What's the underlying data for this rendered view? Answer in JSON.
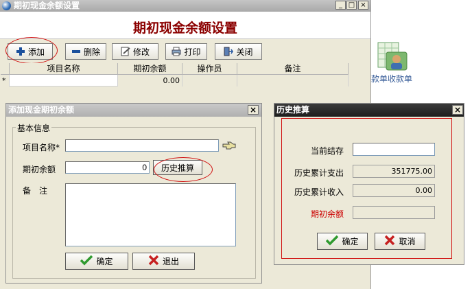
{
  "desktop": {
    "shortcut_label": "款单收款单"
  },
  "main_window": {
    "title": "期初现金余额设置",
    "heading": "期初现金余额设置",
    "toolbar": {
      "add": "添加",
      "delete": "删除",
      "edit": "修改",
      "print": "打印",
      "close": "关闭"
    },
    "grid": {
      "columns": [
        "项目名称",
        "期初余额",
        "操作员",
        "备注"
      ],
      "new_row_marker": "*",
      "new_row_balance": "0.00"
    }
  },
  "add_dialog": {
    "title": "添加现金期初余额",
    "group_title": "基本信息",
    "item_name_label": "项目名称*",
    "item_name_value": "",
    "opening_balance_label": "期初余额",
    "opening_balance_value": "0",
    "history_button": "历史推算",
    "note_label": "备　注",
    "note_value": "",
    "ok_button": "确定",
    "exit_button": "退出"
  },
  "history_dialog": {
    "title": "历史推算",
    "current_balance_label": "当前结存",
    "current_balance_value": "",
    "expense_label": "历史累计支出",
    "expense_value": "351775.00",
    "income_label": "历史累计收入",
    "income_value": "0.00",
    "opening_label": "期初余额",
    "opening_value": "",
    "ok_button": "确定",
    "cancel_button": "取消"
  },
  "colors": {
    "heading": "#8b0000",
    "opening_label": "#cc0000",
    "annotation": "#d01010",
    "check_icon": "#2f9a2f",
    "x_icon": "#c62020"
  }
}
